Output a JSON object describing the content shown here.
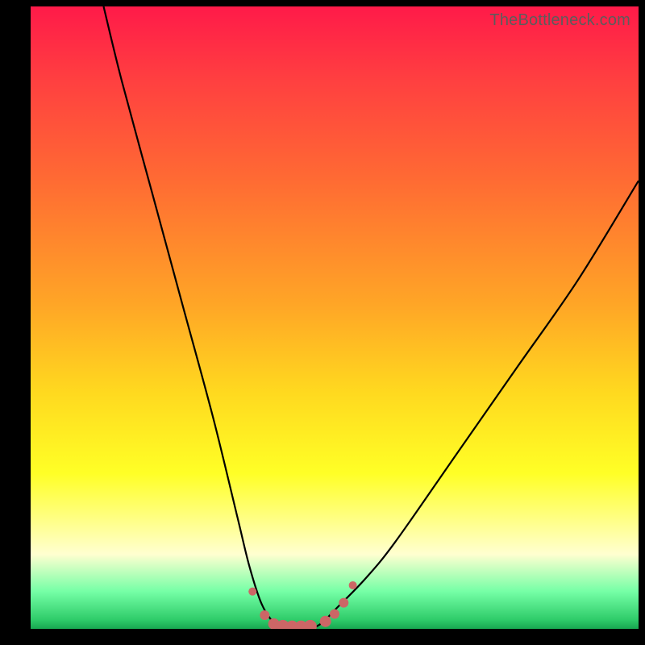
{
  "watermark": "TheBottleneck.com",
  "chart_data": {
    "type": "line",
    "title": "",
    "xlabel": "",
    "ylabel": "",
    "xlim": [
      0,
      100
    ],
    "ylim": [
      0,
      100
    ],
    "series": [
      {
        "name": "bottleneck-curve",
        "x": [
          12,
          15,
          20,
          25,
          30,
          34,
          36,
          38,
          40,
          42,
          44,
          46,
          48,
          50,
          55,
          60,
          70,
          80,
          90,
          100
        ],
        "y": [
          100,
          88,
          70,
          52,
          34,
          18,
          10,
          4,
          1,
          0,
          0,
          0,
          1,
          3,
          8,
          14,
          28,
          42,
          56,
          72
        ]
      }
    ],
    "markers": {
      "name": "highlight-dots",
      "color": "#cc6666",
      "points_x": [
        36.5,
        38.5,
        40,
        41.5,
        43,
        44.5,
        46,
        48.5,
        50,
        51.5,
        53
      ],
      "points_y": [
        6,
        2.2,
        0.8,
        0.4,
        0.3,
        0.3,
        0.4,
        1.2,
        2.4,
        4.2,
        7
      ],
      "radii": [
        5,
        6,
        7,
        8,
        8,
        8,
        8,
        7,
        6,
        6,
        5
      ]
    },
    "gradient_stops": [
      {
        "pos": 0.0,
        "color": "#ff1a49"
      },
      {
        "pos": 0.28,
        "color": "#ff6b33"
      },
      {
        "pos": 0.62,
        "color": "#ffd91f"
      },
      {
        "pos": 0.88,
        "color": "#ffffd0"
      },
      {
        "pos": 0.98,
        "color": "#2fcc6a"
      }
    ]
  }
}
